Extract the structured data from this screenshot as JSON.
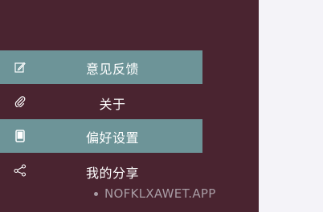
{
  "menu": {
    "items": [
      {
        "label": "意见反馈",
        "icon": "edit-icon",
        "highlighted": true
      },
      {
        "label": "关于",
        "icon": "paperclip-icon",
        "highlighted": false
      },
      {
        "label": "偏好设置",
        "icon": "phone-icon",
        "highlighted": true
      },
      {
        "label": "我的分享",
        "icon": "share-icon",
        "highlighted": false
      }
    ]
  },
  "watermark": {
    "text": "NOFKLXAWET.APP"
  },
  "colors": {
    "drawer_bg": "#4a2430",
    "highlight_bg": "#6d9498",
    "right_pane_bg": "#f4f3f8",
    "text": "#ffffff"
  }
}
